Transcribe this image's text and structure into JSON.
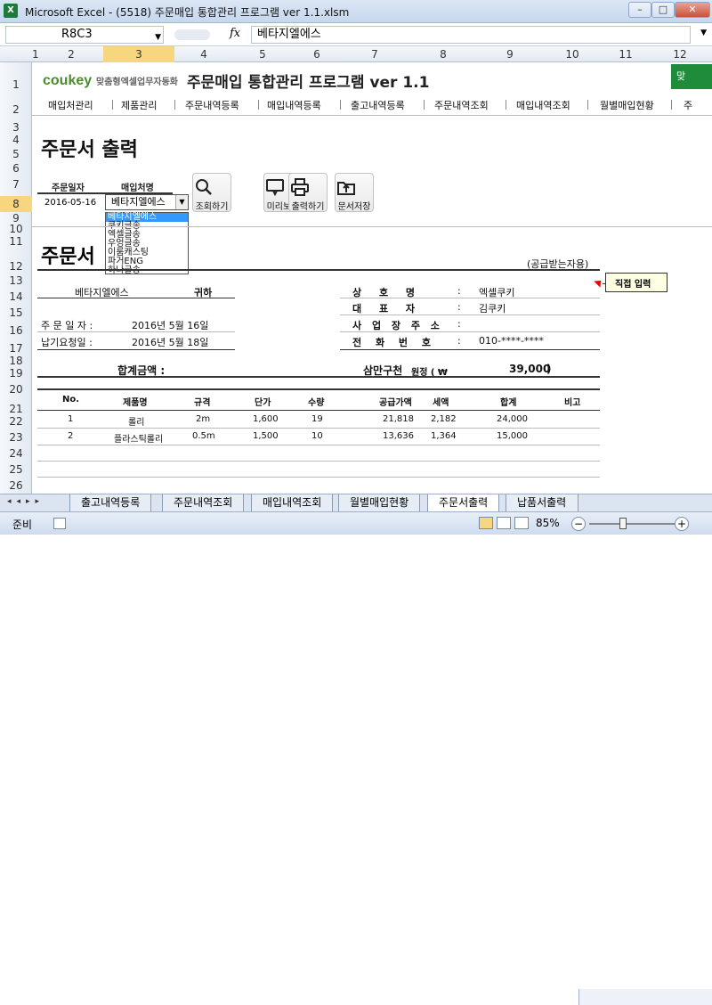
{
  "window": {
    "title": "Microsoft Excel - (5518) 주문매입 통합관리 프로그램 ver 1.1.xlsm",
    "minimize": "–",
    "restore": "□",
    "close": "✕"
  },
  "formula_bar": {
    "name_box": "R8C3",
    "fx": "fx",
    "value": "베타지엘에스"
  },
  "columns": [
    "1",
    "2",
    "3",
    "4",
    "5",
    "6",
    "7",
    "8",
    "9",
    "10",
    "11",
    "12"
  ],
  "rows": [
    "1",
    "2",
    "3",
    "4",
    "5",
    "6",
    "7",
    "8",
    "9",
    "10",
    "11",
    "12",
    "13",
    "14",
    "15",
    "16",
    "17",
    "18",
    "19",
    "20",
    "21",
    "22",
    "23",
    "24",
    "25",
    "26"
  ],
  "header": {
    "logo": "coukey",
    "logo_sub": "맞춤형엑셀업무자동화",
    "app_title": "주문매입 통합관리 프로그램 ver 1.1",
    "corner_btn": "맞"
  },
  "menu": [
    "매입처관리",
    "제품관리",
    "주문내역등록",
    "매입내역등록",
    "출고내역등록",
    "주문내역조회",
    "매입내역조회",
    "월별매입현황",
    "주"
  ],
  "page_title": "주문서 출력",
  "filter": {
    "date_label": "주문일자",
    "vendor_label": "매입처명",
    "date_value": "2016-05-16",
    "vendor_value": "베타지엘에스"
  },
  "dropdown_options": [
    "베타지엘에스",
    "쿠키글송",
    "엑셀글송",
    "우엉글송",
    "이룸캐스팅",
    "파거ENG",
    "하나글송"
  ],
  "tools": [
    "조회하기",
    "미리보기",
    "출력하기",
    "문서저장"
  ],
  "doc": {
    "title": "주문서",
    "copy_label": "(공급받는자용)",
    "recipient": "베타지엘에스",
    "recipient_suffix": "귀하",
    "order_date_label": "주 문 일 자 :",
    "order_date": "2016년 5월 16일",
    "due_date_label": "납기요청일 :",
    "due_date": "2016년 5월 18일",
    "company_label": "상 호 명",
    "company": "엑셀쿠키",
    "ceo_label": "대 표 자",
    "ceo": "김쿠키",
    "address_label": "사 업 장 주 소",
    "address": "",
    "phone_label": "전 화 번 호",
    "phone": "010-****-****",
    "colon": ":",
    "total_label": "합계금액 :",
    "total_korean": "삼만구천",
    "total_won": "원정 ( ₩",
    "total_value": "39,000",
    "total_close": ")",
    "note": "직접 입력"
  },
  "table": {
    "headers": [
      "No.",
      "제품명",
      "규격",
      "단가",
      "수량",
      "공급가액",
      "세액",
      "합계",
      "비고"
    ],
    "rows": [
      [
        "1",
        "롤리",
        "2m",
        "1,600",
        "19",
        "21,818",
        "2,182",
        "24,000",
        ""
      ],
      [
        "2",
        "플라스틱롤리",
        "0.5m",
        "1,500",
        "10",
        "13,636",
        "1,364",
        "15,000",
        ""
      ]
    ]
  },
  "sheet_tabs": [
    "출고내역등록",
    "주문내역조회",
    "매입내역조회",
    "월별매입현황",
    "주문서출력",
    "납품서출력"
  ],
  "status": {
    "ready": "준비",
    "zoom": "85%",
    "minus": "−",
    "plus": "+"
  }
}
